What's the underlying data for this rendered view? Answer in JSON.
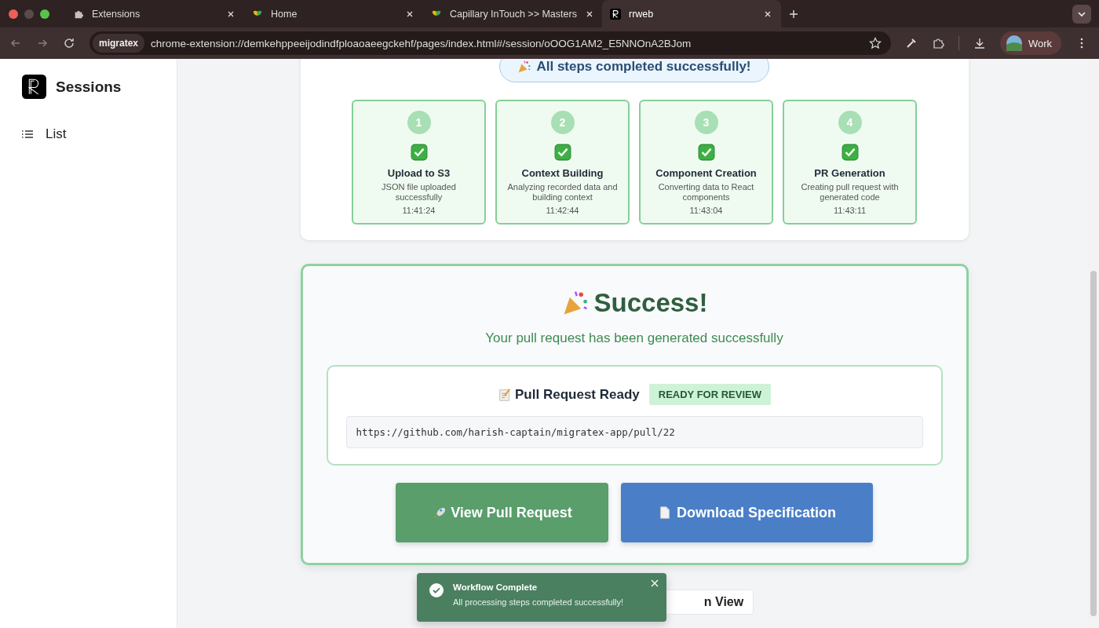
{
  "browser": {
    "tabs": [
      {
        "title": "Extensions",
        "kind": "puzzle",
        "selected": false
      },
      {
        "title": "Home",
        "kind": "leaf",
        "selected": false
      },
      {
        "title": "Capillary InTouch >> Masters",
        "kind": "leaf",
        "selected": false
      },
      {
        "title": "rrweb",
        "kind": "logo",
        "selected": true
      }
    ],
    "site_chip": "migratex",
    "url": "chrome-extension://demkehppeeijodindfploaoaeegckehf/pages/index.html#/session/oOOG1AM2_E5NNOnA2BJom",
    "profile": "Work"
  },
  "sidebar": {
    "title": "Sessions",
    "items": [
      {
        "label": "List",
        "selected": false
      }
    ]
  },
  "progress": {
    "banner": "All steps completed successfully!",
    "steps": [
      {
        "number": "1",
        "done": true,
        "title": "Upload to S3",
        "description": "JSON file uploaded successfully",
        "time": "11:41:24"
      },
      {
        "number": "2",
        "done": true,
        "title": "Context Building",
        "description": "Analyzing recorded data and building context",
        "time": "11:42:44"
      },
      {
        "number": "3",
        "done": true,
        "title": "Component Creation",
        "description": "Converting data to React components",
        "time": "11:43:04"
      },
      {
        "number": "4",
        "done": true,
        "title": "PR Generation",
        "description": "Creating pull request with generated code",
        "time": "11:43:11"
      }
    ]
  },
  "success": {
    "title": "Success!",
    "subtitle": "Your pull request has been generated successfully",
    "pr": {
      "title": "Pull Request Ready",
      "badge": "READY FOR REVIEW",
      "url": "https://github.com/harish-captain/migratex-app/pull/22"
    },
    "buttons": [
      {
        "label": "View Pull Request",
        "kind": "primary"
      },
      {
        "label": "Download Specification",
        "kind": "secondary"
      }
    ]
  },
  "hidden_button": "n View",
  "toast": {
    "title": "Workflow Complete",
    "message": "All processing steps completed successfully!"
  }
}
